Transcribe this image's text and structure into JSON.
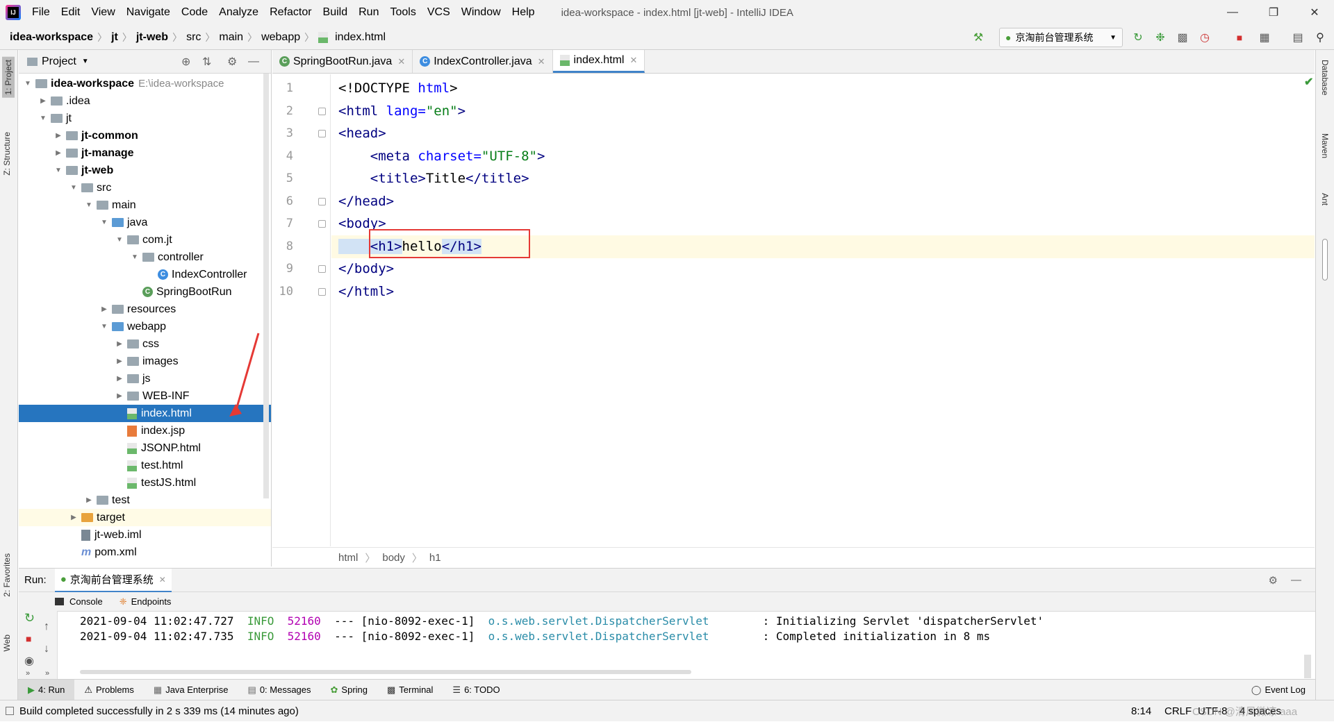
{
  "menubar": {
    "items": [
      "File",
      "Edit",
      "View",
      "Navigate",
      "Code",
      "Analyze",
      "Refactor",
      "Build",
      "Run",
      "Tools",
      "VCS",
      "Window",
      "Help"
    ],
    "window_title": "idea-workspace - index.html [jt-web] - IntelliJ IDEA"
  },
  "navbar": {
    "crumbs": [
      "idea-workspace",
      "jt",
      "jt-web",
      "src",
      "main",
      "webapp",
      "index.html"
    ],
    "run_config": "京淘前台管理系统"
  },
  "left_strip": {
    "project": "1: Project",
    "structure": "Z: Structure",
    "favorites": "2: Favorites",
    "web": "Web"
  },
  "right_strip": {
    "database": "Database",
    "maven": "Maven",
    "ant": "Ant"
  },
  "project_panel": {
    "title": "Project",
    "tree": [
      {
        "label": "idea-workspace",
        "extra": "E:\\idea-workspace",
        "bold": true
      },
      {
        "label": ".idea"
      },
      {
        "label": "jt"
      },
      {
        "label": "jt-common",
        "bold": true
      },
      {
        "label": "jt-manage",
        "bold": true
      },
      {
        "label": "jt-web",
        "bold": true
      },
      {
        "label": "src"
      },
      {
        "label": "main"
      },
      {
        "label": "java"
      },
      {
        "label": "com.jt"
      },
      {
        "label": "controller"
      },
      {
        "label": "IndexController"
      },
      {
        "label": "SpringBootRun"
      },
      {
        "label": "resources"
      },
      {
        "label": "webapp"
      },
      {
        "label": "css"
      },
      {
        "label": "images"
      },
      {
        "label": "js"
      },
      {
        "label": "WEB-INF"
      },
      {
        "label": "index.html"
      },
      {
        "label": "index.jsp"
      },
      {
        "label": "JSONP.html"
      },
      {
        "label": "test.html"
      },
      {
        "label": "testJS.html"
      },
      {
        "label": "test"
      },
      {
        "label": "target"
      },
      {
        "label": "jt-web.iml"
      },
      {
        "label": "pom.xml"
      }
    ]
  },
  "editor": {
    "tabs": [
      "SpringBootRun.java",
      "IndexController.java",
      "index.html"
    ],
    "active_tab": "index.html",
    "line_numbers": [
      "1",
      "2",
      "3",
      "4",
      "5",
      "6",
      "7",
      "8",
      "9",
      "10"
    ],
    "lines": [
      {
        "a": "<!DOCTYPE ",
        "b": "html",
        "c": ">"
      },
      {
        "a": "<html ",
        "b": "lang=",
        "c": "\"en\"",
        "d": ">"
      },
      {
        "a": "<head>"
      },
      {
        "a": "    <meta ",
        "b": "charset=",
        "c": "\"UTF-8\"",
        "d": ">"
      },
      {
        "a": "    <title>",
        "b": "Title",
        "c": "</title>"
      },
      {
        "a": "</head>"
      },
      {
        "a": "<body>"
      },
      {
        "a": "    <h1>",
        "b": "hello",
        "c": "</h1>"
      },
      {
        "a": "</body>"
      },
      {
        "a": "</html>"
      }
    ],
    "breadcrumb": [
      "html",
      "body",
      "h1"
    ],
    "cursor_line": 8
  },
  "run_panel": {
    "label": "Run:",
    "tab": "京淘前台管理系统",
    "subtabs": [
      "Console",
      "Endpoints"
    ],
    "log": [
      {
        "ts": "2021-09-04 11:02:47.727",
        "level": "INFO",
        "pid": "52160",
        "thread": "--- [nio-8092-exec-1]",
        "logger": "o.s.web.servlet.DispatcherServlet",
        "msg": "        : Initializing Servlet 'dispatcherServlet'"
      },
      {
        "ts": "2021-09-04 11:02:47.735",
        "level": "INFO",
        "pid": "52160",
        "thread": "--- [nio-8092-exec-1]",
        "logger": "o.s.web.servlet.DispatcherServlet",
        "msg": "        : Completed initialization in 8 ms"
      }
    ]
  },
  "bottom_tabs": [
    "4: Run",
    "Problems",
    "Java Enterprise",
    "0: Messages",
    "Spring",
    "Terminal",
    "6: TODO"
  ],
  "event_log": "Event Log",
  "statusbar": {
    "message": "Build completed successfully in 2 s 339 ms (14 minutes ago)",
    "position": "8:14",
    "line_sep": "CRLF",
    "encoding": "UTF-8",
    "indent": "4 spaces",
    "watermark": "CSDN @清风微凉 aaa"
  },
  "colors": {
    "selection": "#2675bf",
    "highlight_box": "#e53935",
    "tag": "#000080",
    "attr": "#0000ff",
    "string": "#067d17"
  }
}
